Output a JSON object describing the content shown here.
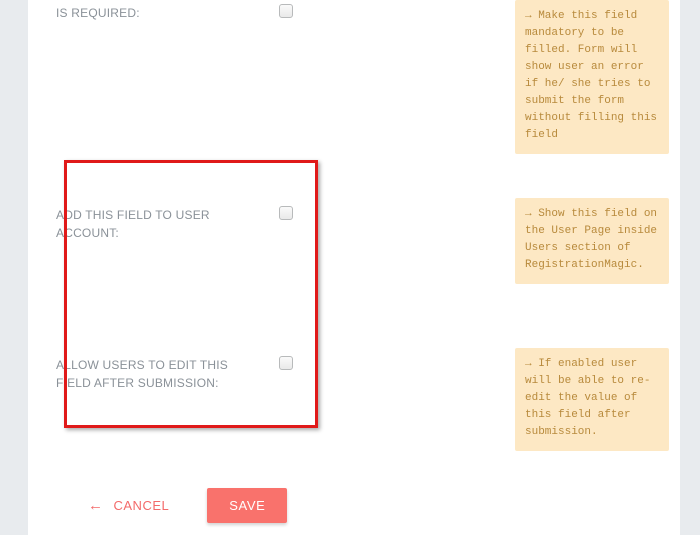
{
  "fields": {
    "is_required": {
      "label": "IS REQUIRED:",
      "help": "→ Make this field mandatory to be filled. Form will show user an error if he/ she tries to submit the form without filling this field"
    },
    "add_to_user_account": {
      "label": "ADD THIS FIELD TO USER ACCOUNT:",
      "help": "→ Show this field on the User Page inside Users section of RegistrationMagic."
    },
    "allow_edit_after_submission": {
      "label": "ALLOW USERS TO EDIT THIS FIELD AFTER SUBMISSION:",
      "help": "→ If enabled user will be able to re-edit the value of this field after submission."
    }
  },
  "footer": {
    "cancel_arrow": "←",
    "cancel_label": "CANCEL",
    "save_label": "SAVE"
  }
}
